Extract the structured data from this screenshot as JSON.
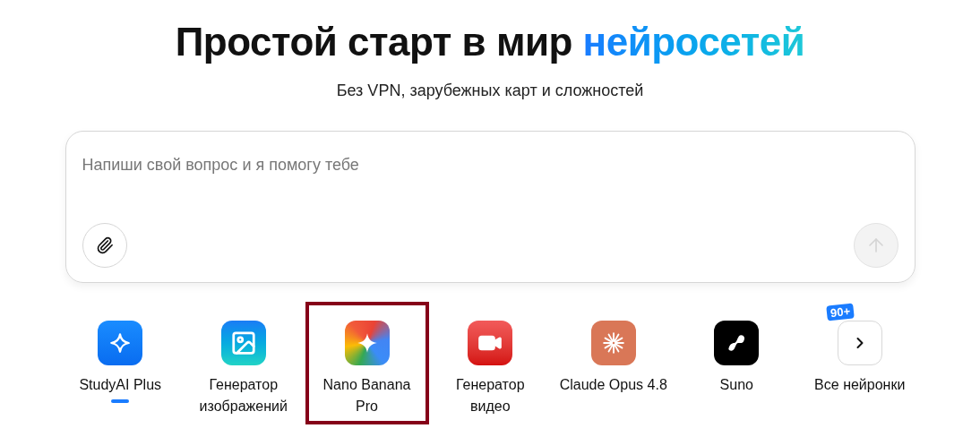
{
  "header": {
    "title": "Простой старт в мир",
    "title_accent": "нейросетей",
    "subtitle": "Без VPN, зарубежных карт и сложностей"
  },
  "prompt": {
    "placeholder": "Напиши свой вопрос и я помогу тебе",
    "send_disabled": true
  },
  "models": [
    {
      "kind": "studyai",
      "label": "StudyAI Plus",
      "selected": true,
      "highlighted": false
    },
    {
      "kind": "image",
      "label": "Генератор изображений",
      "selected": false,
      "highlighted": false
    },
    {
      "kind": "banana",
      "label": "Nano Banana Pro",
      "selected": false,
      "highlighted": true
    },
    {
      "kind": "video",
      "label": "Генератор видео",
      "selected": false,
      "highlighted": false
    },
    {
      "kind": "claude",
      "label": "Claude Opus 4.8",
      "selected": false,
      "highlighted": false
    },
    {
      "kind": "suno",
      "label": "Suno",
      "selected": false,
      "highlighted": false
    },
    {
      "kind": "all",
      "label": "Все нейронки",
      "badge": "90+",
      "selected": false,
      "highlighted": false
    }
  ]
}
